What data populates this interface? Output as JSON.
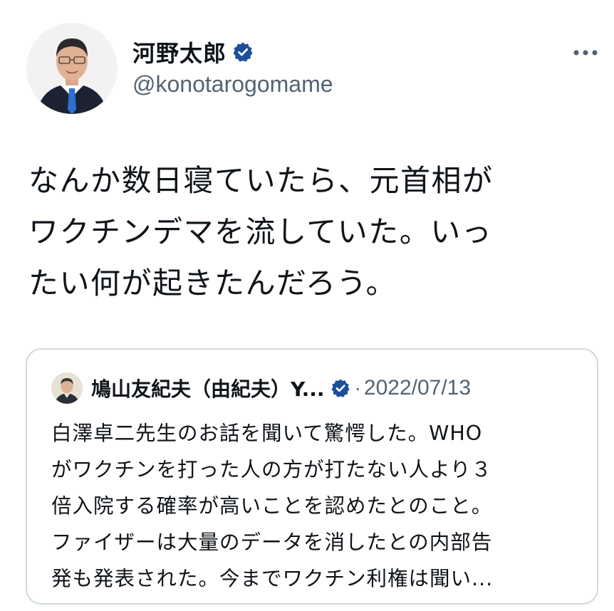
{
  "tweet": {
    "author": {
      "display_name": "河野太郎",
      "handle": "@konotarogomame",
      "verified": true,
      "avatar": "portrait-photo"
    },
    "text_lines": [
      "なんか数日寝ていたら、元首相が",
      "ワクチンデマを流していた。いっ",
      "たい何が起きたんだろう。"
    ],
    "more_icon": "more-horizontal-icon"
  },
  "quote": {
    "author": {
      "display_name": "鳩山友紀夫（由紀夫）Y...",
      "verified": true,
      "avatar": "portrait-photo-small"
    },
    "separator": "·",
    "date": "2022/07/13",
    "text_lines": [
      "白澤卓二先生のお話を聞いて驚愕した。WHO",
      "がワクチンを打った人の方が打たない人より３",
      "倍入院する確率が高いことを認めたとのこと。",
      "ファイザーは大量のデータを消したとの内部告",
      "発も発表された。今までワクチン利権は聞い..."
    ]
  },
  "colors": {
    "text": "#0f1419",
    "secondary": "#536471",
    "verified": "#1d4e9b",
    "border": "#cfd9de"
  }
}
